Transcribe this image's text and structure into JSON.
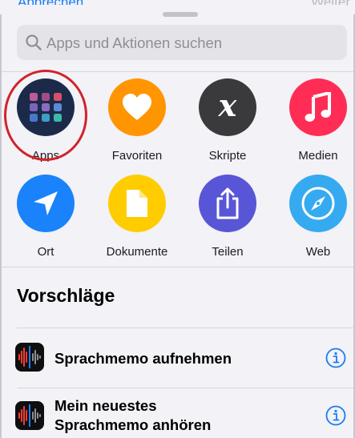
{
  "behind": {
    "left": "Abbrechen",
    "right": "Weiter"
  },
  "search": {
    "placeholder": "Apps und Aktionen suchen"
  },
  "categories": [
    {
      "label": "Apps",
      "icon": "apps-grid-icon",
      "color": "#1c2a4a"
    },
    {
      "label": "Favoriten",
      "icon": "heart-icon",
      "color": "#ff9500"
    },
    {
      "label": "Skripte",
      "icon": "script-x-icon",
      "color": "#3a3a3c"
    },
    {
      "label": "Medien",
      "icon": "music-note-icon",
      "color": "#ff2d55"
    },
    {
      "label": "Ort",
      "icon": "location-arrow-icon",
      "color": "#1a82fb"
    },
    {
      "label": "Dokumente",
      "icon": "document-icon",
      "color": "#ffcc00"
    },
    {
      "label": "Teilen",
      "icon": "share-icon",
      "color": "#5856d6"
    },
    {
      "label": "Web",
      "icon": "compass-icon",
      "color": "#36aaf0"
    }
  ],
  "suggestions": {
    "title": "Vorschläge",
    "items": [
      {
        "line1": "Sprachmemo aufnehmen",
        "line2": "",
        "icon": "voice-memos-icon"
      },
      {
        "line1": "Mein neuestes",
        "line2": "Sprachmemo anhören",
        "icon": "voice-memos-icon"
      }
    ]
  },
  "colors": {
    "accent": "#1a7cf5",
    "highlight_ring": "#d2232a"
  }
}
